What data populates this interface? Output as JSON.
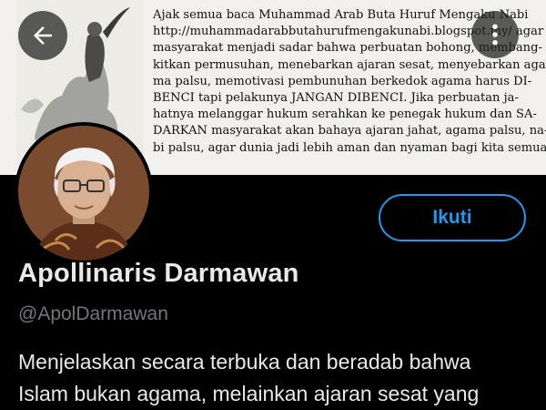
{
  "banner": {
    "lines": [
      "Ajak semua baca Muhammad Arab Buta Huruf Mengaku Nabi",
      "http://muhammadarabbutahurufmengakunabi.blogspot.my/ agar",
      "masyarakat menjadi sadar bahwa perbuatan bohong, membang-",
      "kitkan permusuhan, menebarkan ajaran sesat, menyebarkan aga-",
      "ma palsu, memotivasi pembunuhan berkedok agama harus DI-",
      "BENCI tapi pelakunya JANGAN DIBENCI. Jika perbuatan ja-",
      "hatnya melanggar hukum serahkan ke penegak hukum dan SA-",
      "DARKAN masyarakat akan bahaya ajaran jahat, agama palsu, na-",
      "bi palsu, agar dunia jadi lebih aman dan nyaman bagi kita semua."
    ]
  },
  "header": {
    "back_icon": "arrow-left-icon",
    "more_icon": "more-vertical-icon"
  },
  "profile": {
    "display_name": "Apollinaris Darmawan",
    "handle": "@ApolDarmawan",
    "follow_label": "Ikuti",
    "bio_lines": [
      "Menjelaskan secara terbuka dan beradab bahwa",
      "Islam bukan agama, melainkan ajaran sesat yang"
    ]
  },
  "colors": {
    "background": "#000000",
    "accent": "#1d9bf0",
    "text_primary": "#e7e9ea",
    "text_secondary": "#71767b"
  }
}
